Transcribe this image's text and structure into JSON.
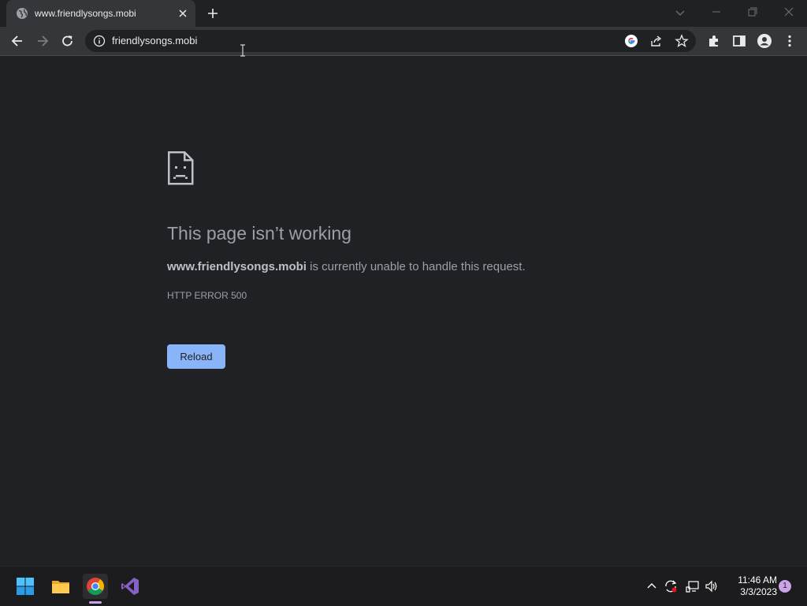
{
  "browser": {
    "tab": {
      "title": "www.friendlysongs.mobi"
    },
    "omnibox": {
      "url": "friendlysongs.mobi"
    }
  },
  "error_page": {
    "heading": "This page isn’t working",
    "message_host": "www.friendlysongs.mobi",
    "message_rest": " is currently unable to handle this request.",
    "error_code": "HTTP ERROR 500",
    "reload_label": "Reload"
  },
  "taskbar": {
    "apps": [
      "start-icon",
      "file-explorer-icon",
      "chrome-icon",
      "visual-studio-icon"
    ],
    "clock": {
      "time": "11:46 AM",
      "date": "3/3/2023"
    },
    "notification_count": "1"
  },
  "colors": {
    "background": "#202124",
    "toolbar": "#35363a",
    "accent_button": "#8ab4f8",
    "text_muted": "#9aa0a6"
  }
}
